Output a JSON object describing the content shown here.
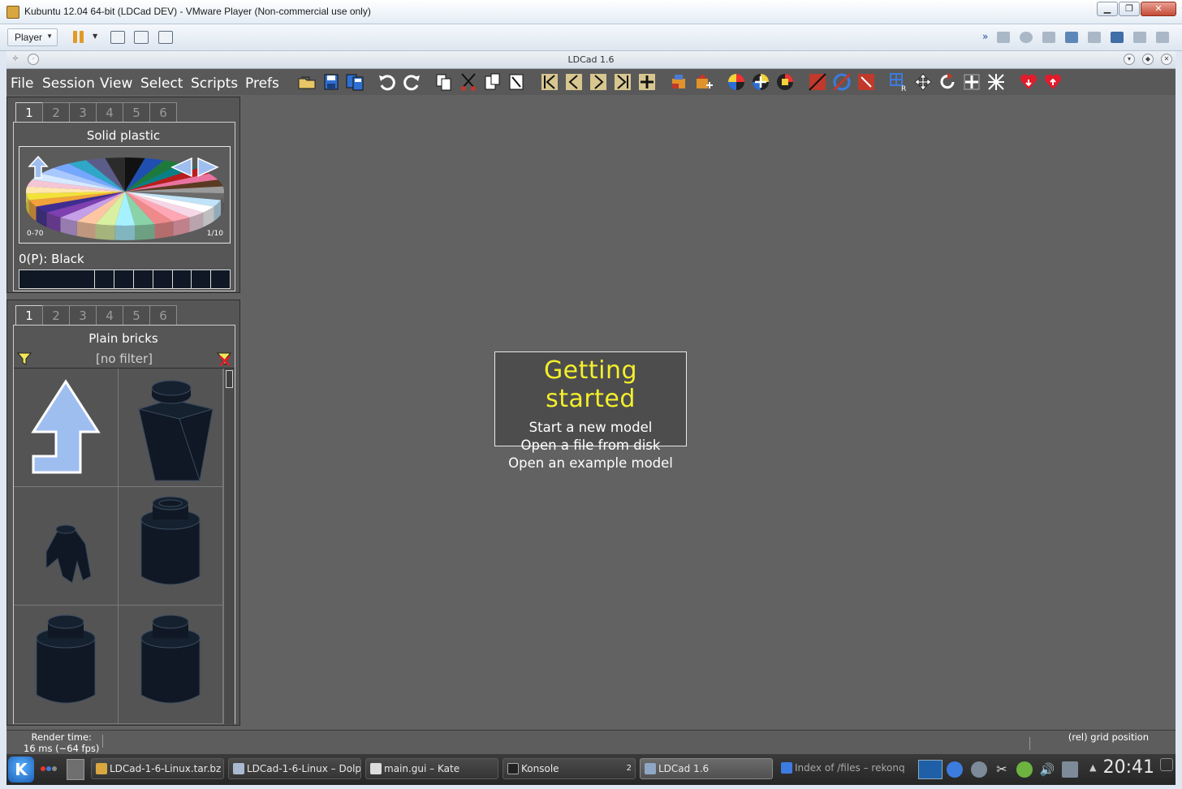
{
  "host": {
    "window_title": "Kubuntu 12.04 64-bit (LDCad DEV) - VMware Player (Non-commercial use only)",
    "player_label": "Player"
  },
  "ldcad": {
    "window_title": "LDCad 1.6",
    "menu": [
      "File",
      "Session",
      "View",
      "Select",
      "Scripts",
      "Prefs"
    ]
  },
  "color_panel": {
    "tabs": [
      "1",
      "2",
      "3",
      "4",
      "5",
      "6"
    ],
    "title": "Solid plastic",
    "range_label": "0-70",
    "page_label": "1/10",
    "selected_color": "0(P): Black"
  },
  "parts_panel": {
    "tabs": [
      "1",
      "2",
      "3",
      "4",
      "5",
      "6"
    ],
    "title": "Plain bricks",
    "filter": "[no filter]"
  },
  "getting_started": {
    "title": "Getting started",
    "items": [
      "Start a new model",
      "Open a file from disk",
      "Open an example model"
    ]
  },
  "status": {
    "render_label": "Render time:",
    "render_value": "16 ms (~64 fps)",
    "grid": "(rel) grid position"
  },
  "taskbar": {
    "tasks": [
      "LDCad-1-6-Linux.tar.bz",
      "LDCad-1-6-Linux – Dolp",
      "main.gui – Kate",
      "Konsole",
      "LDCad 1.6",
      "Index of /files – rekonq"
    ],
    "konsole_badge": "2",
    "clock": "20:41"
  },
  "colors": {
    "accent_title": "#f4ef2c",
    "workspace": "#626262",
    "brick": "#0f1824"
  }
}
